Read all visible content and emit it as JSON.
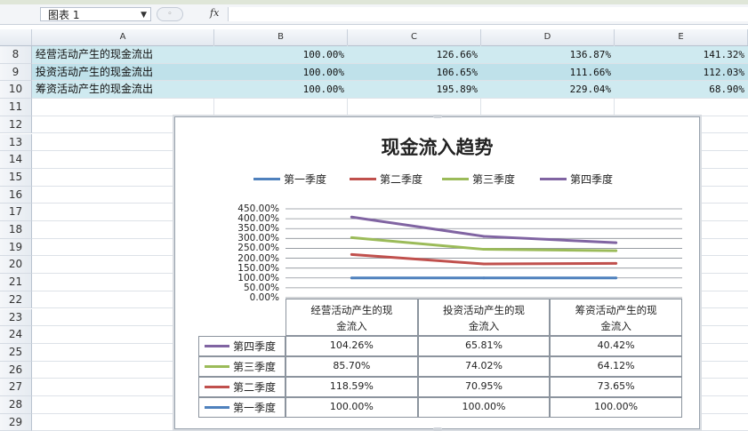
{
  "formula_bar": {
    "name_box": "图表 1",
    "fx_label": "fx",
    "formula": ""
  },
  "columns": [
    "A",
    "B",
    "C",
    "D",
    "E"
  ],
  "rows": [
    {
      "num": "8",
      "label": "经营活动产生的现金流出",
      "values": [
        "100.00%",
        "126.66%",
        "136.87%",
        "141.32%"
      ]
    },
    {
      "num": "9",
      "label": "投资活动产生的现金流出",
      "values": [
        "100.00%",
        "106.65%",
        "111.66%",
        "112.03%"
      ]
    },
    {
      "num": "10",
      "label": "筹资活动产生的现金流出",
      "values": [
        "100.00%",
        "195.89%",
        "229.04%",
        "68.90%"
      ]
    },
    {
      "num": "11"
    },
    {
      "num": "12"
    },
    {
      "num": "13"
    },
    {
      "num": "14"
    },
    {
      "num": "15"
    },
    {
      "num": "16"
    },
    {
      "num": "17"
    },
    {
      "num": "18"
    },
    {
      "num": "19"
    },
    {
      "num": "20"
    },
    {
      "num": "21"
    },
    {
      "num": "22"
    },
    {
      "num": "23"
    },
    {
      "num": "24"
    },
    {
      "num": "25"
    },
    {
      "num": "26"
    },
    {
      "num": "27"
    },
    {
      "num": "28"
    },
    {
      "num": "29"
    }
  ],
  "chart_data": {
    "type": "line",
    "title": "现金流入趋势",
    "categories": [
      "经营活动产生的现金流入",
      "投资活动产生的现金流入",
      "筹资活动产生的现金流入"
    ],
    "category_labels": [
      [
        "经营活动产生的现",
        "金流入"
      ],
      [
        "投资活动产生的现",
        "金流入"
      ],
      [
        "筹资活动产生的现",
        "金流入"
      ]
    ],
    "y_ticks": [
      "450.00%",
      "400.00%",
      "350.00%",
      "300.00%",
      "250.00%",
      "200.00%",
      "150.00%",
      "100.00%",
      "50.00%",
      "0.00%"
    ],
    "ylim": [
      0,
      450
    ],
    "grid": true,
    "legend_position": "top",
    "series": [
      {
        "name": "第一季度",
        "color": "#4f81bd",
        "values": [
          100,
          100,
          100
        ],
        "labels": [
          "100.00%",
          "100.00%",
          "100.00%"
        ]
      },
      {
        "name": "第二季度",
        "color": "#c0504d",
        "values": [
          218.59,
          170.95,
          173.65
        ],
        "labels": [
          "118.59%",
          "70.95%",
          "73.65%"
        ]
      },
      {
        "name": "第三季度",
        "color": "#9bbb59",
        "values": [
          304.29,
          244.97,
          237.77
        ],
        "labels": [
          "85.70%",
          "74.02%",
          "64.12%"
        ]
      },
      {
        "name": "第四季度",
        "color": "#8064a2",
        "values": [
          408.55,
          310.78,
          278.19
        ],
        "labels": [
          "104.26%",
          "65.81%",
          "40.42%"
        ]
      }
    ],
    "table_order": [
      3,
      2,
      1,
      0
    ]
  }
}
